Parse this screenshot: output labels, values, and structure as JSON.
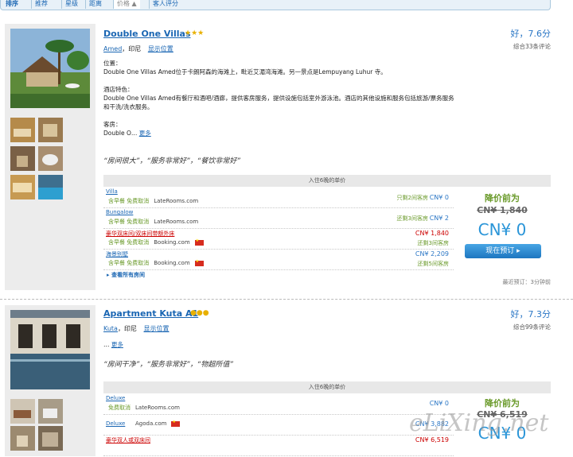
{
  "sortbar": {
    "label": "排序",
    "tabs": [
      "推荐",
      "星级",
      "距离",
      "价格 ▲",
      "客人评分"
    ]
  },
  "hotel1": {
    "name": "Double One Villas",
    "stars": "★★★",
    "city": "Amed",
    "country": "，印尼",
    "map_link": "显示位置",
    "rating": "好，7.6分",
    "reviews": "综合33条评论",
    "desc_label_loc": "位置：",
    "desc_loc": "Double One Villas Amed位于卡朗阿森的海滩上，毗近艾湄湾海滩。另一景点是Lempuyang Luhur 寺。",
    "desc_label_feat": "酒店特色：",
    "desc_feat": "Double One Villas Amed有餐厅和酒吧/酒廊，提供客房服务，提供设施包括室外游泳池。酒店的其他设施和服务包括旅游/票务服务和干洗/洗衣服务。",
    "desc_label_room": "客房：",
    "desc_room": "Double O…",
    "more": "更多",
    "quote": "“房间很大”，“服务非常好”，“餐饮非常好”",
    "price_header": "入住6晚的单价",
    "rooms": [
      {
        "name": "Villa",
        "meta": "含早餐 免费取消",
        "source": "LateRooms.com",
        "warn": "只剩2间客房",
        "price": "CN¥ 0"
      },
      {
        "name": "Bungalow",
        "meta": "含早餐 免费取消",
        "source": "LateRooms.com",
        "warn": "还剩3间客房",
        "price": "CN¥ 2"
      },
      {
        "name": "豪华双床间/双床间带额外床",
        "meta": "含早餐 免费取消",
        "source": "Booking.com",
        "warn": "还剩3间客房",
        "price": "CN¥ 1,840"
      },
      {
        "name": "海景别墅",
        "meta": "含早餐 免费取消",
        "source": "Booking.com",
        "warn": "还剩5间客房",
        "price": "CN¥ 2,209"
      }
    ],
    "drop_label": "降价前为",
    "old_price": "CN¥ 1,840",
    "new_price": "CN¥ 0",
    "book_btn": "现在预订",
    "see_all": "▸ 查看所有房间",
    "last_booked": "最近预订：3分钟前"
  },
  "hotel2": {
    "name": "Apartment Kuta A1",
    "stars": "●●●",
    "city": "Kuta",
    "country": "，印尼",
    "map_link": "显示位置",
    "rating": "好，7.3分",
    "reviews": "综合99条评论",
    "desc": "…",
    "more": "更多",
    "quote": "“房间干净”，“服务非常好”，“物超所值”",
    "price_header": "入住6晚的单价",
    "rooms": [
      {
        "name": "Deluxe",
        "meta": "免费取消",
        "source": "LateRooms.com",
        "price": "CN¥ 0"
      },
      {
        "name": "Deluxe",
        "meta": "",
        "source": "Agoda.com",
        "price": "CN¥ 3,882"
      },
      {
        "name": "豪华双人或双床间",
        "meta": "",
        "source": "",
        "price": "CN¥ 6,519"
      }
    ],
    "drop_label": "降价前为",
    "old_price": "CN¥ 6,519",
    "new_price": "CN¥ 0"
  },
  "watermark": "eLiXing.net"
}
